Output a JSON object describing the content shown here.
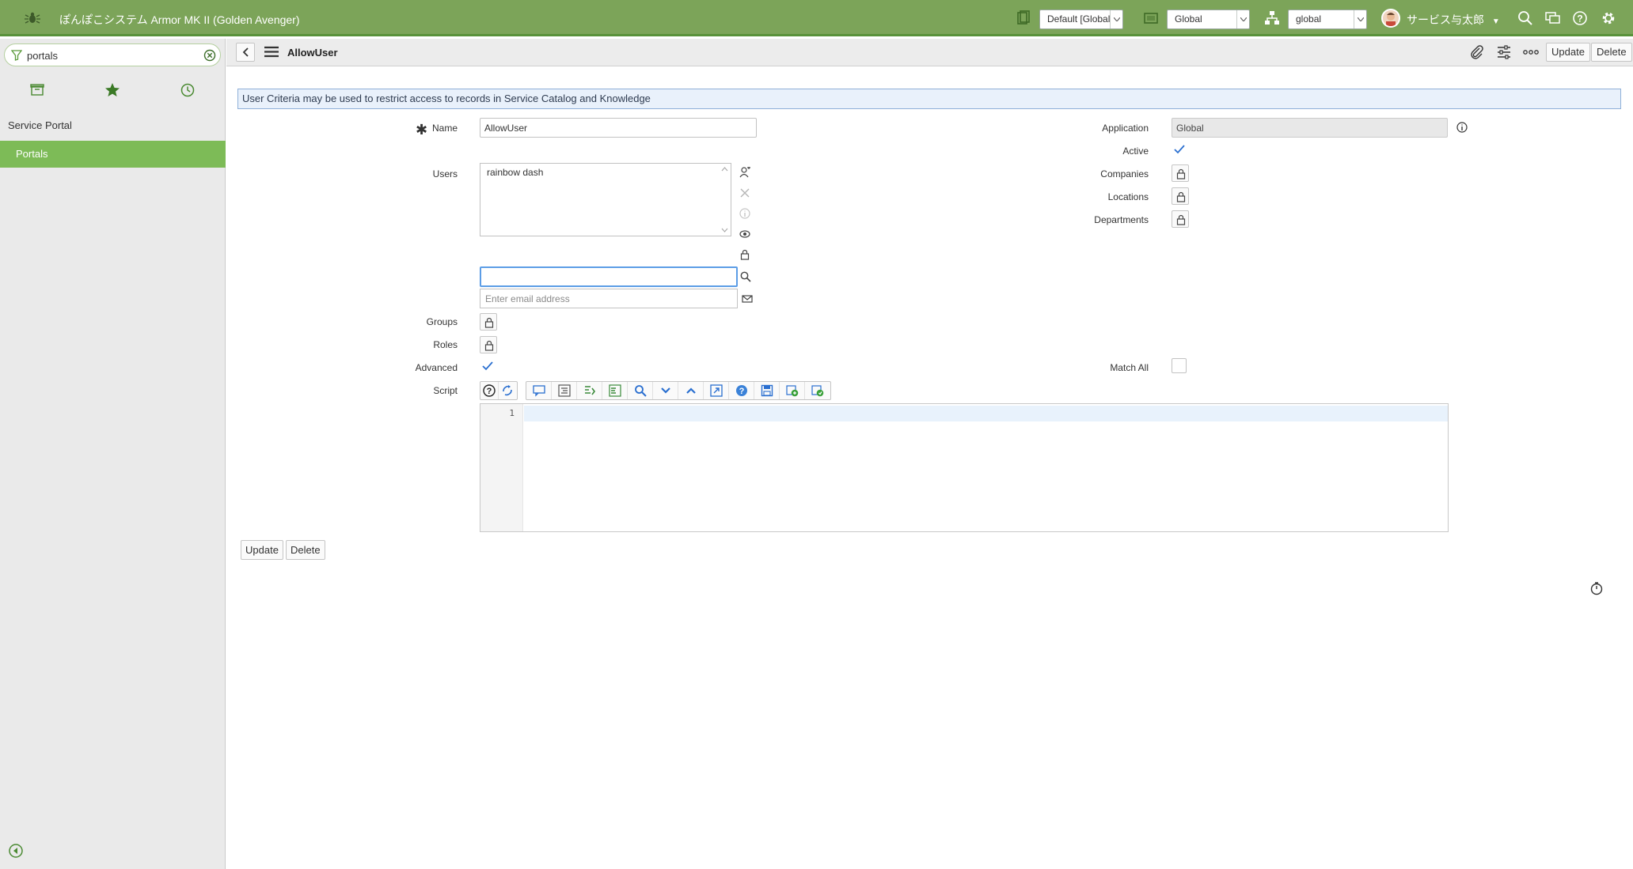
{
  "header": {
    "app_title": "ぽんぽこシステム Armor MK II (Golden Avenger)",
    "update_set": "Default [Global",
    "scope": "Global",
    "domain": "global",
    "user_name": "サービス与太郎",
    "brand_color": "#7ca459"
  },
  "nav": {
    "filter_value": "portals",
    "tabs": [
      "all-apps-icon",
      "favorites-star-icon",
      "history-clock-icon"
    ],
    "modules": [
      {
        "label": "Service Portal"
      },
      {
        "label": "Portals"
      }
    ],
    "active_color": "#7dbb57"
  },
  "form": {
    "title": "AllowUser",
    "update_label": "Update",
    "delete_label": "Delete",
    "info_message": "User Criteria may be used to restrict access to records in Service Catalog and Knowledge",
    "fields": {
      "name": {
        "label": "Name",
        "value": "AllowUser"
      },
      "users": {
        "label": "Users",
        "value": "rainbow dash"
      },
      "email_placeholder": "Enter email address",
      "groups": {
        "label": "Groups"
      },
      "roles": {
        "label": "Roles"
      },
      "advanced": {
        "label": "Advanced",
        "checked": true
      },
      "script": {
        "label": "Script",
        "line_number": "1"
      },
      "application": {
        "label": "Application",
        "value": "Global"
      },
      "active": {
        "label": "Active",
        "checked": true
      },
      "companies": {
        "label": "Companies"
      },
      "locations": {
        "label": "Locations"
      },
      "departments": {
        "label": "Departments"
      },
      "match_all": {
        "label": "Match All",
        "checked": false
      }
    },
    "footer": {
      "update_label": "Update",
      "delete_label": "Delete"
    }
  }
}
